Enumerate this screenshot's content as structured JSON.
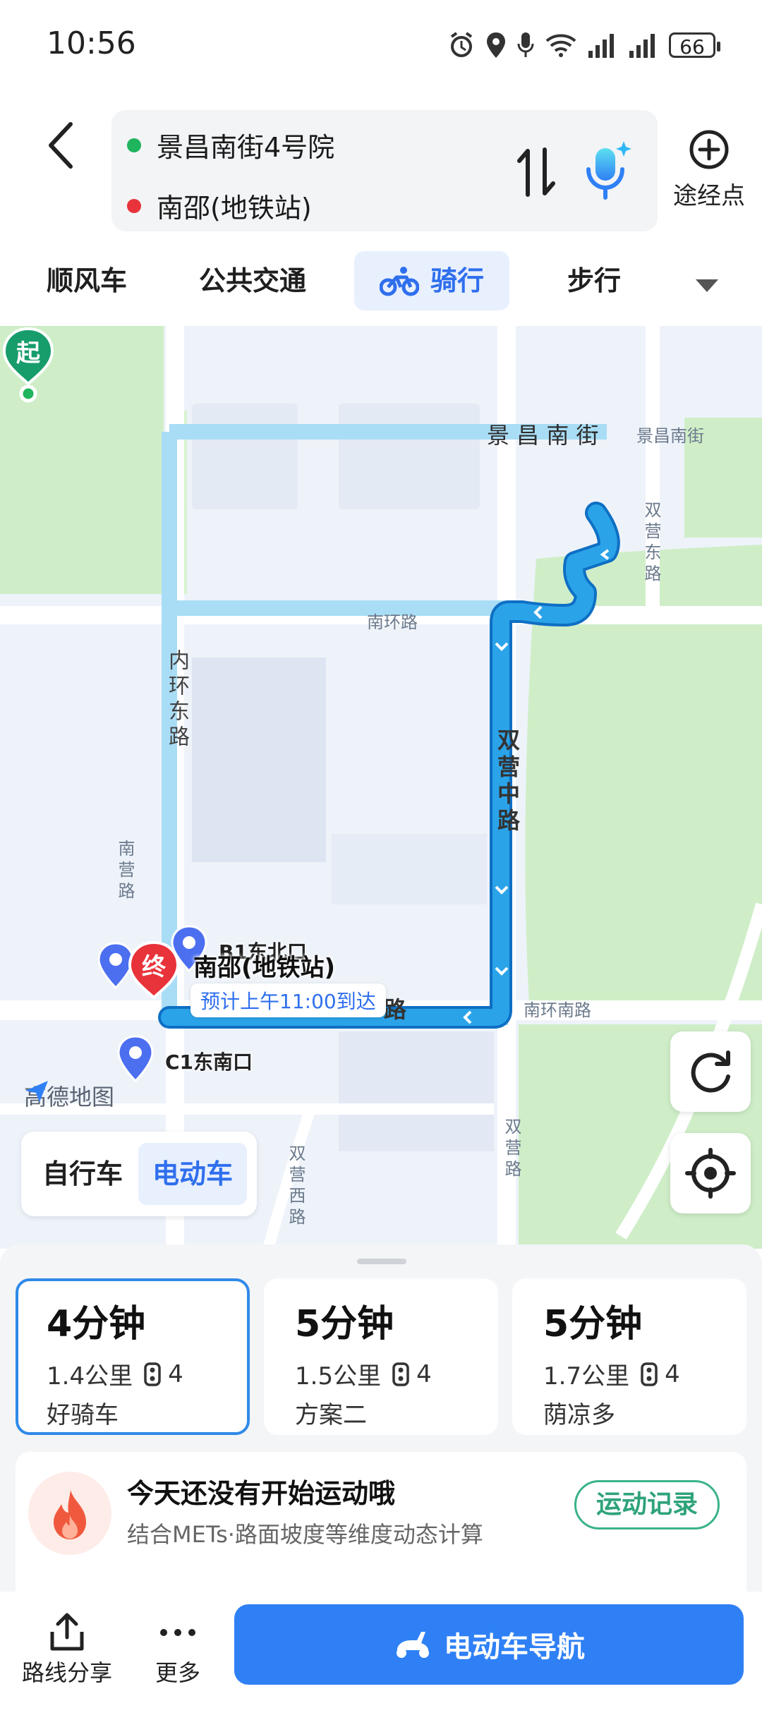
{
  "status_bar": {
    "time": "10:56",
    "battery": "66"
  },
  "route": {
    "origin": "景昌南街4号院",
    "destination": "南邵(地铁站)",
    "waypoint_label": "途经点",
    "origin_color": "#1fb45e",
    "destination_color": "#e8333a"
  },
  "tabs": [
    {
      "label": "顺风车"
    },
    {
      "label": "公共交通"
    },
    {
      "label": "骑行",
      "active": true
    },
    {
      "label": "步行"
    }
  ],
  "map": {
    "labels": {
      "jingchang_nanjie_small": "景昌南街",
      "jingchang_nanjie_big": "景  昌  南  街",
      "nanhuan_lu": "南环路",
      "nanhuan_nanlu": "南环南路",
      "shuangying_dong_lu": "双营东路",
      "shuangying_zhong_lu": "双营中路",
      "neihuan_dong_lu": "内环东路",
      "nanying_lu": "南营路",
      "shuangying_lu": "双营路",
      "shuangying_xi_lu": "双营西路",
      "lu_fragment": "路"
    },
    "start_pin": "起",
    "end_pin": "终",
    "poi": {
      "b1": "B1东北口",
      "c1": "C1东南口"
    },
    "destination_name": "南邵(地铁站)",
    "eta": "预计上午11:00到达",
    "brand": "高德地图",
    "vehicle_toggle": {
      "bike": "自行车",
      "ebike": "电动车"
    }
  },
  "options": [
    {
      "duration": "4分钟",
      "distance": "1.4公里",
      "lights": "4",
      "tag": "好骑车",
      "selected": true
    },
    {
      "duration": "5分钟",
      "distance": "1.5公里",
      "lights": "4",
      "tag": "方案二"
    },
    {
      "duration": "5分钟",
      "distance": "1.7公里",
      "lights": "4",
      "tag": "荫凉多"
    }
  ],
  "sport": {
    "title": "今天还没有开始运动哦",
    "subtitle": "结合METs·路面坡度等维度动态计算",
    "button": "运动记录"
  },
  "bottom_bar": {
    "share": "路线分享",
    "more": "更多",
    "navigate": "电动车导航"
  },
  "colors": {
    "accent": "#2f80f5",
    "route": "#2ba3e8",
    "alt_route": "#a9ddf5",
    "park": "#cfeec8"
  }
}
